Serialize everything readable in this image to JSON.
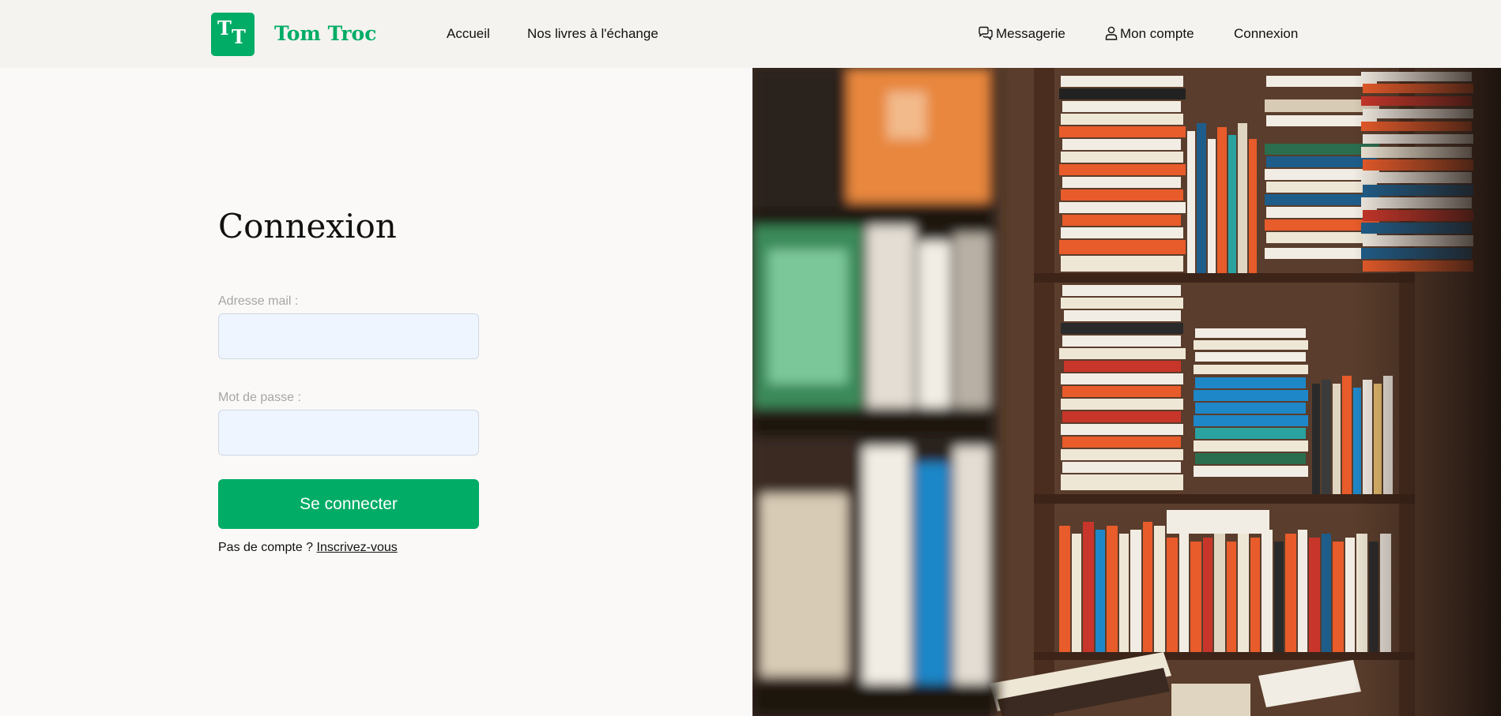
{
  "brand": {
    "name": "Tom Troc",
    "logo_letters": [
      "T",
      "T"
    ],
    "color": "#00ac66"
  },
  "nav": {
    "accueil": "Accueil",
    "livres": "Nos livres à l'échange",
    "messagerie": "Messagerie",
    "messagerie_icon": "chat-bubbles-icon",
    "compte": "Mon compte",
    "compte_icon": "user-icon",
    "connexion": "Connexion"
  },
  "form": {
    "title": "Connexion",
    "email_label": "Adresse mail :",
    "email_value": "",
    "password_label": "Mot de passe :",
    "password_value": "",
    "submit_label": "Se connecter",
    "signup_prompt": "Pas de compte ?",
    "signup_link": "Inscrivez-vous"
  },
  "hero_image": {
    "subject": "bookshelves-photo"
  }
}
